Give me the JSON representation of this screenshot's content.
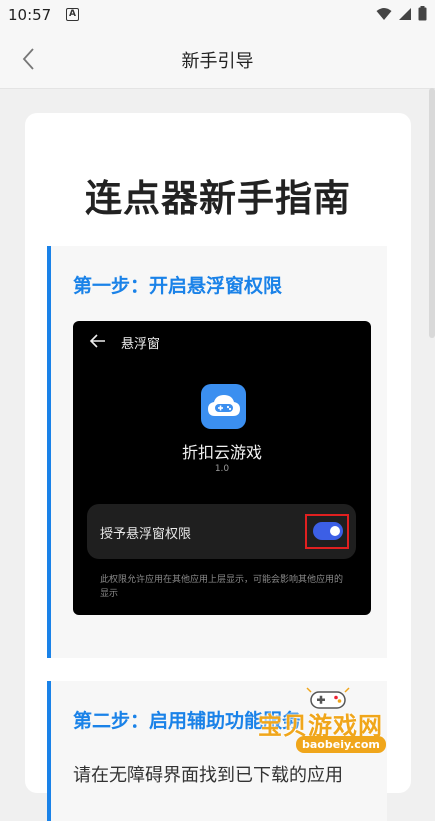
{
  "status_bar": {
    "time": "10:57",
    "notification_glyph": "A",
    "icons": [
      "wifi-icon",
      "signal-icon",
      "battery-icon"
    ]
  },
  "header": {
    "title": "新手引导",
    "back_icon": "chevron-left-icon"
  },
  "guide": {
    "title": "连点器新手指南",
    "accent_color": "#1a82e8",
    "steps": [
      {
        "title": "第一步：开启悬浮窗权限",
        "screenshot": {
          "screen_title": "悬浮窗",
          "app_name": "折扣云游戏",
          "app_version": "1.0",
          "permission_label": "授予悬浮窗权限",
          "toggle_on": true,
          "note": "此权限允许应用在其他应用上层显示，可能会影响其他应用的显示"
        }
      },
      {
        "title": "第二步：启用辅助功能服务",
        "description": "请在无障碍界面找到已下载的应用"
      }
    ]
  },
  "watermark": {
    "text": "宝贝游戏网",
    "url": "baobeiy.com"
  }
}
